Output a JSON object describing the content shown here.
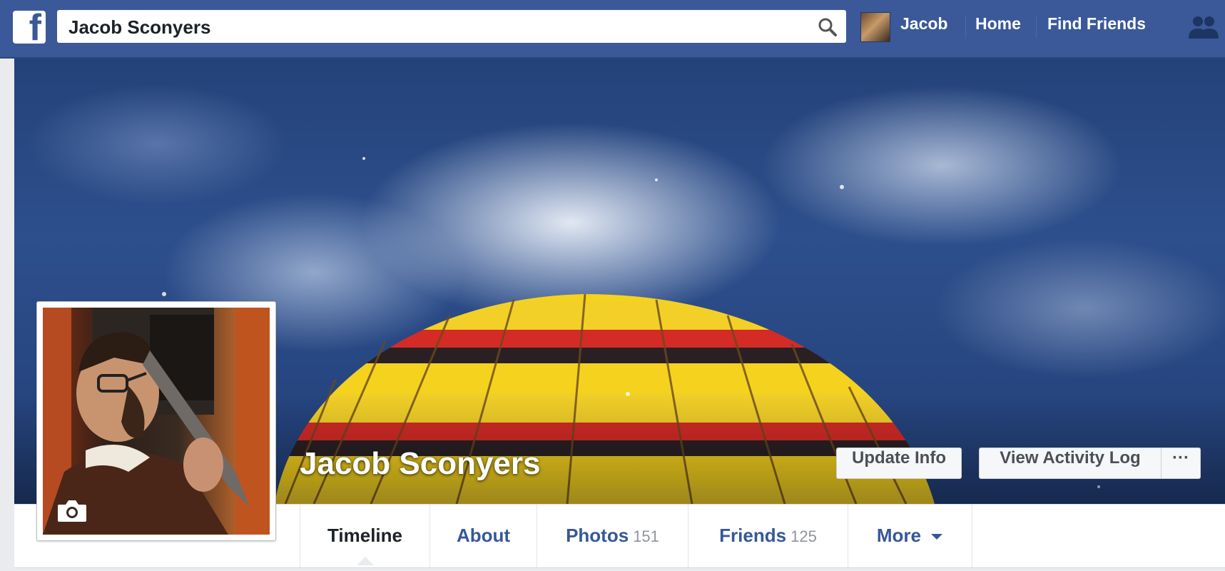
{
  "topbar": {
    "search_value": "Jacob Sconyers",
    "user_name": "Jacob",
    "home_label": "Home",
    "find_friends_label": "Find Friends"
  },
  "profile": {
    "name": "Jacob Sconyers",
    "update_info_label": "Update Info",
    "activity_log_label": "View Activity Log",
    "more_options_label": "···"
  },
  "tabs": [
    {
      "label": "Timeline",
      "count": ""
    },
    {
      "label": "About",
      "count": ""
    },
    {
      "label": "Photos",
      "count": "151"
    },
    {
      "label": "Friends",
      "count": "125"
    },
    {
      "label": "More",
      "count": ""
    }
  ],
  "colors": {
    "brand": "#3b5998",
    "link": "#365899"
  },
  "icons": {
    "logo": "facebook-logo",
    "search": "search-icon",
    "friend_requests": "friend-requests-icon",
    "camera": "camera-icon",
    "more_caret": "caret-down-icon"
  }
}
